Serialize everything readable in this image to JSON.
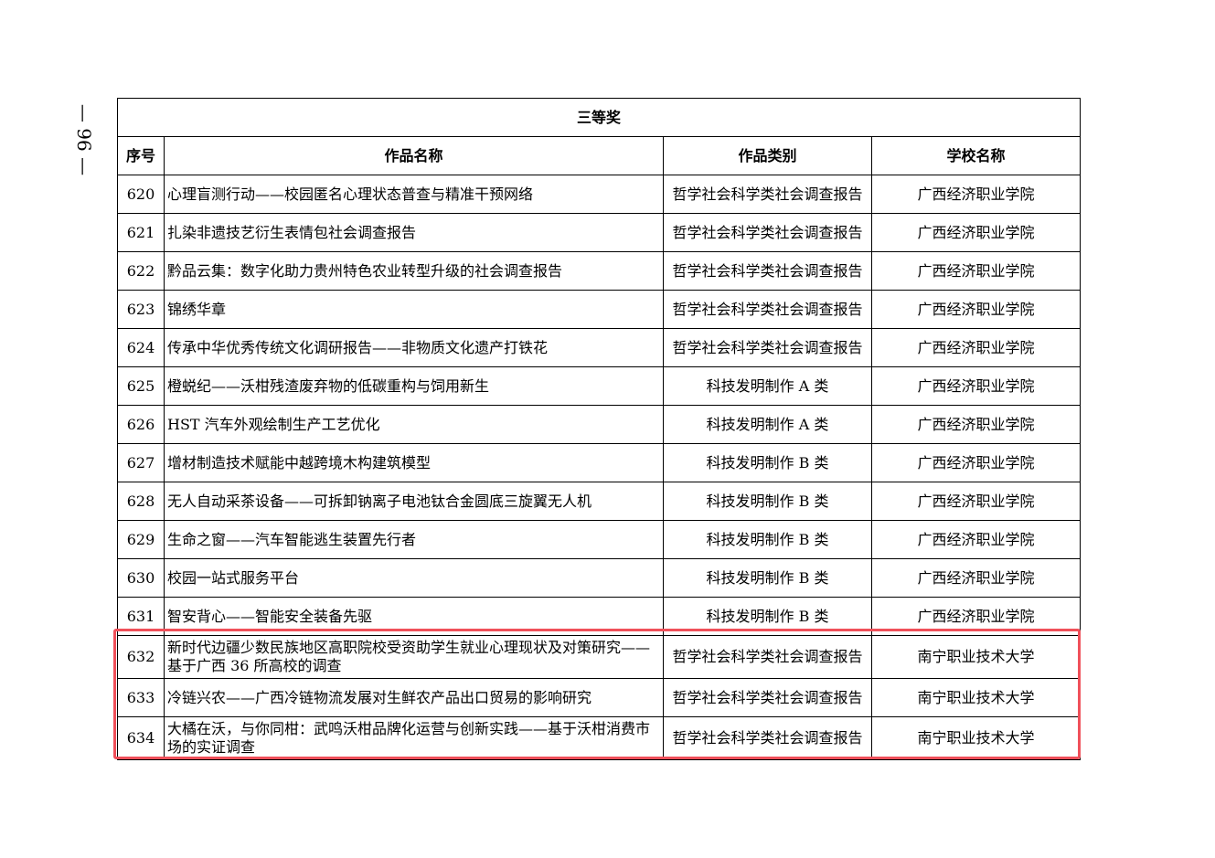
{
  "page_number": "— 96 —",
  "table": {
    "title": "三等奖",
    "headers": {
      "no": "序号",
      "name": "作品名称",
      "category": "作品类别",
      "school": "学校名称"
    },
    "rows": [
      {
        "no": "620",
        "name": "心理盲测行动——校园匿名心理状态普查与精准干预网络",
        "category": "哲学社会科学类社会调查报告",
        "school": "广西经济职业学院"
      },
      {
        "no": "621",
        "name": "扎染非遗技艺衍生表情包社会调查报告",
        "category": "哲学社会科学类社会调查报告",
        "school": "广西经济职业学院"
      },
      {
        "no": "622",
        "name": "黔品云集：数字化助力贵州特色农业转型升级的社会调查报告",
        "category": "哲学社会科学类社会调查报告",
        "school": "广西经济职业学院"
      },
      {
        "no": "623",
        "name": "锦绣华章",
        "category": "哲学社会科学类社会调查报告",
        "school": "广西经济职业学院"
      },
      {
        "no": "624",
        "name": "传承中华优秀传统文化调研报告——非物质文化遗产打铁花",
        "category": "哲学社会科学类社会调查报告",
        "school": "广西经济职业学院"
      },
      {
        "no": "625",
        "name": "橙蜕纪——沃柑残渣废弃物的低碳重构与饲用新生",
        "category": "科技发明制作 A 类",
        "school": "广西经济职业学院"
      },
      {
        "no": "626",
        "name": "HST 汽车外观绘制生产工艺优化",
        "category": "科技发明制作 A 类",
        "school": "广西经济职业学院"
      },
      {
        "no": "627",
        "name": "增材制造技术赋能中越跨境木构建筑模型",
        "category": "科技发明制作 B 类",
        "school": "广西经济职业学院"
      },
      {
        "no": "628",
        "name": "无人自动采茶设备——可拆卸钠离子电池钛合金圆底三旋翼无人机",
        "category": "科技发明制作 B 类",
        "school": "广西经济职业学院"
      },
      {
        "no": "629",
        "name": "生命之窗——汽车智能逃生装置先行者",
        "category": "科技发明制作 B 类",
        "school": "广西经济职业学院"
      },
      {
        "no": "630",
        "name": "校园一站式服务平台",
        "category": "科技发明制作 B 类",
        "school": "广西经济职业学院"
      },
      {
        "no": "631",
        "name": "智安背心——智能安全装备先驱",
        "category": "科技发明制作 B 类",
        "school": "广西经济职业学院"
      },
      {
        "no": "632",
        "name": "新时代边疆少数民族地区高职院校受资助学生就业心理现状及对策研究——基于广西 36 所高校的调查",
        "category": "哲学社会科学类社会调查报告",
        "school": "南宁职业技术大学"
      },
      {
        "no": "633",
        "name": "冷链兴农——广西冷链物流发展对生鲜农产品出口贸易的影响研究",
        "category": "哲学社会科学类社会调查报告",
        "school": "南宁职业技术大学"
      },
      {
        "no": "634",
        "name": "大橘在沃，与你同柑：武鸣沃柑品牌化运营与创新实践——基于沃柑消费市场的实证调查",
        "category": "哲学社会科学类社会调查报告",
        "school": "南宁职业技术大学"
      }
    ]
  },
  "highlight_color": "#f0505a"
}
